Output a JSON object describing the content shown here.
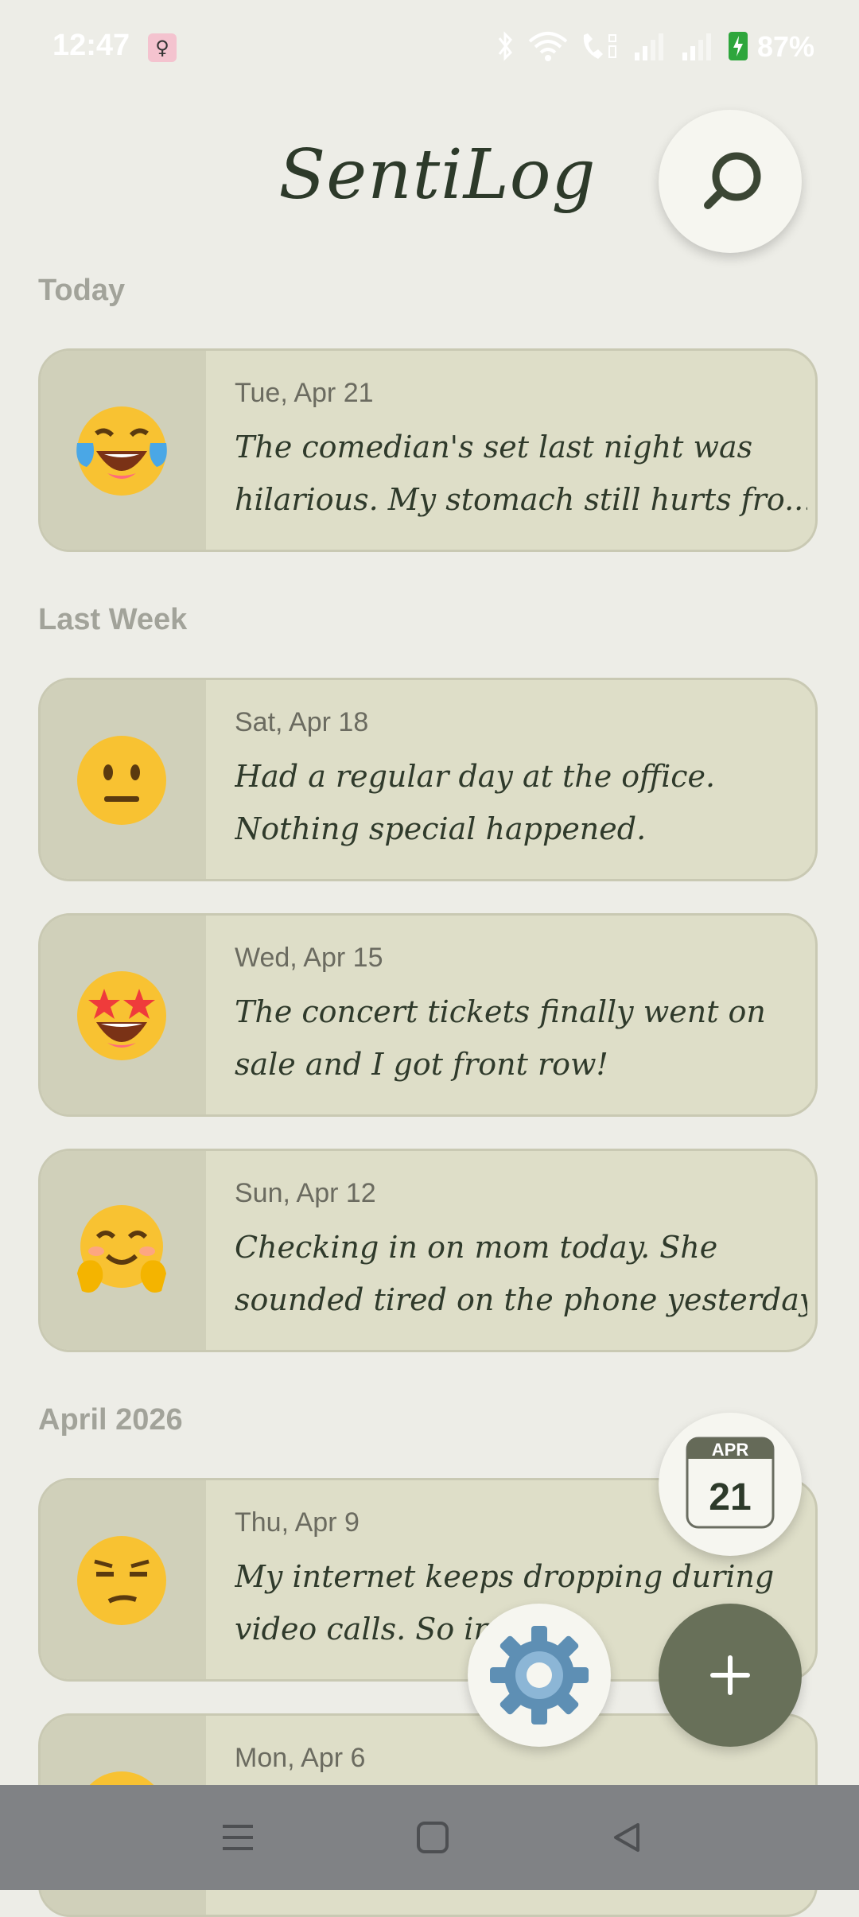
{
  "status_bar": {
    "time": "12:47",
    "battery": "87%"
  },
  "app": {
    "title": "SentiLog"
  },
  "sections": {
    "today": "Today",
    "last_week": "Last Week",
    "april": "April 2026"
  },
  "entries": [
    {
      "date": "Tue, Apr 21",
      "line1": "The comedian's set last night was",
      "line2": "hilarious. My stomach still hurts fro...",
      "emoji": "face-with-tears-of-joy-icon"
    },
    {
      "date": "Sat, Apr 18",
      "line1": "Had a regular day at the office.",
      "line2": "Nothing special happened.",
      "emoji": "neutral-face-icon"
    },
    {
      "date": "Wed, Apr 15",
      "line1": "The concert tickets finally went on",
      "line2": "sale and I got front row!",
      "emoji": "star-struck-icon"
    },
    {
      "date": "Sun, Apr 12",
      "line1": "Checking in on mom today. She",
      "line2": "sounded tired on the phone yesterday.",
      "emoji": "hugging-face-icon"
    },
    {
      "date": "Thu, Apr 9",
      "line1": "My internet keeps dropping during",
      "line2": "video calls. So irri",
      "emoji": "unamused-face-icon"
    },
    {
      "date": "Mon, Apr 6",
      "line1": "",
      "line2": "",
      "emoji": "face-icon"
    }
  ],
  "calendar_badge": {
    "month": "APR",
    "day": "21"
  },
  "colors": {
    "background": "#edede7",
    "card": "#dedec8",
    "accent": "#687059"
  }
}
